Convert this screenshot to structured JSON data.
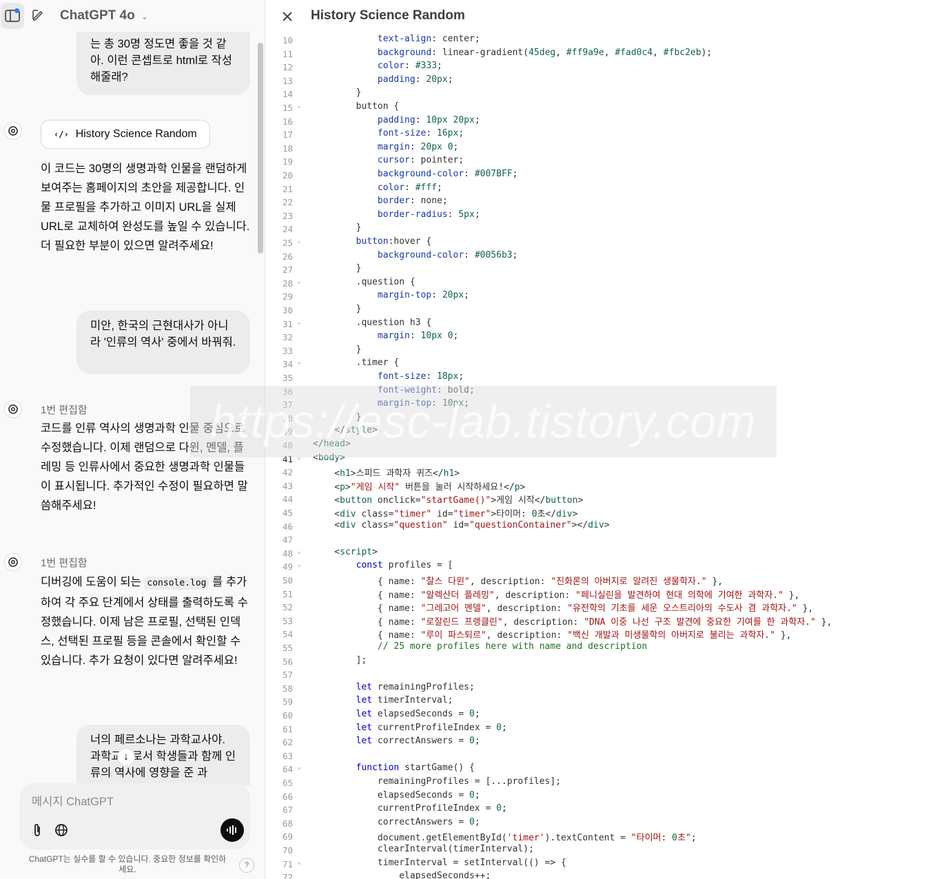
{
  "header": {
    "model_name": "ChatGPT 4o"
  },
  "chat": {
    "user_msg_1": "는 총 30명 정도면 좋을 것 같아. 이런 콘셉트로 html로 작성해줄래?",
    "canvas_button_label": "History Science Random",
    "assistant_msg_1": "이 코드는 30명의 생명과학 인물을 랜덤하게 보여주는 홈페이지의 초안을 제공합니다. 인물 프로필을 추가하고 이미지 URL을 실제 URL로 교체하여 완성도를 높일 수 있습니다. 더 필요한 부분이 있으면 알려주세요!",
    "user_msg_2": "미안, 한국의 근현대사가 아니라 '인류의 역사' 중에서 바꿔줘.",
    "edited_label_1": "1번 편집함",
    "assistant_msg_2": "코드를 인류 역사의 생명과학 인물 중심으로 수정했습니다. 이제 랜덤으로 다윈, 멘델, 플레밍 등 인류사에서 중요한 생명과학 인물들이 표시됩니다. 추가적인 수정이 필요하면 말씀해주세요!",
    "edited_label_2": "1번 편집함",
    "assistant_msg_3_pre": "디버깅에 도움이 되는",
    "assistant_msg_3_code": "console.log",
    "assistant_msg_3_post": "를 추가하여 각 주요 단계에서 상태를 출력하도록 수정했습니다. 이제 남은 프로필, 선택된 인덱스, 선택된 프로필 등을 콘솔에서 확인할 수 있습니다. 추가 요청이 있다면 알려주세요!",
    "user_msg_3": "너의 페르소나는 과학교사야. 과학교사로서 학생들과 함께 인류의 역사에 영향을 준 과"
  },
  "composer": {
    "placeholder": "메시지 ChatGPT"
  },
  "footer": {
    "disclaimer": "ChatGPT는 실수를 할 수 있습니다. 중요한 정보를 확인하세요.",
    "help": "?"
  },
  "canvas": {
    "title": "History Science Random"
  },
  "watermark": "https://esc-lab.tistory.com",
  "code": {
    "active_line": 41,
    "lines": [
      {
        "n": 10,
        "t": "            text-align: center;"
      },
      {
        "n": 11,
        "t": "            background: linear-gradient(45deg, #ff9a9e, #fad0c4, #fbc2eb);"
      },
      {
        "n": 12,
        "t": "            color: #333;"
      },
      {
        "n": 13,
        "t": "            padding: 20px;"
      },
      {
        "n": 14,
        "t": "        }"
      },
      {
        "n": 15,
        "t": "        button {",
        "f": true
      },
      {
        "n": 16,
        "t": "            padding: 10px 20px;"
      },
      {
        "n": 17,
        "t": "            font-size: 16px;"
      },
      {
        "n": 18,
        "t": "            margin: 20px 0;"
      },
      {
        "n": 19,
        "t": "            cursor: pointer;"
      },
      {
        "n": 20,
        "t": "            background-color: #007BFF;"
      },
      {
        "n": 21,
        "t": "            color: #fff;"
      },
      {
        "n": 22,
        "t": "            border: none;"
      },
      {
        "n": 23,
        "t": "            border-radius: 5px;"
      },
      {
        "n": 24,
        "t": "        }"
      },
      {
        "n": 25,
        "t": "        button:hover {",
        "f": true
      },
      {
        "n": 26,
        "t": "            background-color: #0056b3;"
      },
      {
        "n": 27,
        "t": "        }"
      },
      {
        "n": 28,
        "t": "        .question {",
        "f": true
      },
      {
        "n": 29,
        "t": "            margin-top: 20px;"
      },
      {
        "n": 30,
        "t": "        }"
      },
      {
        "n": 31,
        "t": "        .question h3 {",
        "f": true
      },
      {
        "n": 32,
        "t": "            margin: 10px 0;"
      },
      {
        "n": 33,
        "t": "        }"
      },
      {
        "n": 34,
        "t": "        .timer {",
        "f": true
      },
      {
        "n": 35,
        "t": "            font-size: 18px;"
      },
      {
        "n": 36,
        "t": "            font-weight: bold;"
      },
      {
        "n": 37,
        "t": "            margin-top: 10px;"
      },
      {
        "n": 38,
        "t": "        }"
      },
      {
        "n": 39,
        "t": "    </style>"
      },
      {
        "n": 40,
        "t": "</head>"
      },
      {
        "n": 41,
        "t": "<body>",
        "f": true
      },
      {
        "n": 42,
        "t": "    <h1>스피드 과학자 퀴즈</h1>"
      },
      {
        "n": 43,
        "t": "    <p>\"게임 시작\" 버튼을 눌러 시작하세요!</p>"
      },
      {
        "n": 44,
        "t": "    <button onclick=\"startGame()\">게임 시작</button>"
      },
      {
        "n": 45,
        "t": "    <div class=\"timer\" id=\"timer\">타이머: 0초</div>"
      },
      {
        "n": 46,
        "t": "    <div class=\"question\" id=\"questionContainer\"></div>"
      },
      {
        "n": 47,
        "t": ""
      },
      {
        "n": 48,
        "t": "    <script>",
        "f": true
      },
      {
        "n": 49,
        "t": "        const profiles = [",
        "f": true
      },
      {
        "n": 50,
        "t": "            { name: \"찰스 다윈\", description: \"진화론의 아버지로 알려진 생물학자.\" },"
      },
      {
        "n": 51,
        "t": "            { name: \"알렉산더 플레밍\", description: \"페니실린을 발견하여 현대 의학에 기여한 과학자.\" },"
      },
      {
        "n": 52,
        "t": "            { name: \"그레고어 멘델\", description: \"유전학의 기초를 세운 오스트리아의 수도사 겸 과학자.\" },"
      },
      {
        "n": 53,
        "t": "            { name: \"로잘린드 프랭클린\", description: \"DNA 이중 나선 구조 발견에 중요한 기여를 한 과학자.\" },"
      },
      {
        "n": 54,
        "t": "            { name: \"루이 파스퇴르\", description: \"백신 개발과 미생물학의 아버지로 불리는 과학자.\" },"
      },
      {
        "n": 55,
        "t": "            // 25 more profiles here with name and description"
      },
      {
        "n": 56,
        "t": "        ];"
      },
      {
        "n": 57,
        "t": ""
      },
      {
        "n": 58,
        "t": "        let remainingProfiles;"
      },
      {
        "n": 59,
        "t": "        let timerInterval;"
      },
      {
        "n": 60,
        "t": "        let elapsedSeconds = 0;"
      },
      {
        "n": 61,
        "t": "        let currentProfileIndex = 0;"
      },
      {
        "n": 62,
        "t": "        let correctAnswers = 0;"
      },
      {
        "n": 63,
        "t": ""
      },
      {
        "n": 64,
        "t": "        function startGame() {",
        "f": true
      },
      {
        "n": 65,
        "t": "            remainingProfiles = [...profiles];"
      },
      {
        "n": 66,
        "t": "            elapsedSeconds = 0;"
      },
      {
        "n": 67,
        "t": "            currentProfileIndex = 0;"
      },
      {
        "n": 68,
        "t": "            correctAnswers = 0;"
      },
      {
        "n": 69,
        "t": "            document.getElementById('timer').textContent = \"타이머: 0초\";"
      },
      {
        "n": 70,
        "t": "            clearInterval(timerInterval);"
      },
      {
        "n": 71,
        "t": "            timerInterval = setInterval(() => {",
        "f": true
      },
      {
        "n": 72,
        "t": "                elapsedSeconds++;"
      }
    ]
  }
}
